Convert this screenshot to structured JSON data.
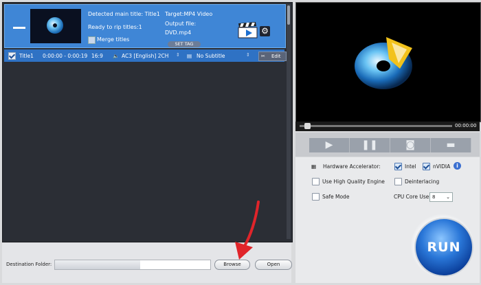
{
  "title_card": {
    "detected_main_title": "Detected main title: Title1",
    "ready_to_rip": "Ready to rip titles:1",
    "merge_titles_label": "Merge titles",
    "target": "Target:MP4 Video",
    "output_file_label": "Output file:",
    "output_file_name": "DVD.mp4",
    "set_tag_label": "SET TAG"
  },
  "track_row": {
    "title": "Title1",
    "time_range": "0:00:00 - 0:00:19",
    "aspect": "16:9",
    "audio": "AC3  [English]  2CH",
    "subtitle": "No Subtitle",
    "edit_label": "Edit"
  },
  "destination": {
    "label": "Destination Folder:",
    "progress": 0.55,
    "browse_label": "Browse",
    "open_label": "Open"
  },
  "preview": {
    "time": "00:00:00",
    "seek_position": 0.03
  },
  "options": {
    "hardware_accelerator_label": "Hardware Accelerator:",
    "intel_label": "Intel",
    "intel_checked": true,
    "nvidia_label": "nVIDIA",
    "nvidia_checked": true,
    "high_quality_label": "Use High Quality Engine",
    "high_quality_checked": false,
    "deinterlacing_label": "Deinterlacing",
    "deinterlacing_checked": false,
    "safe_mode_label": "Safe Mode",
    "safe_mode_checked": false,
    "cpu_core_label": "CPU Core Use:",
    "cpu_core_value": "8"
  },
  "run_label": "RUN",
  "icons": [
    "play-icon",
    "pause-icon",
    "camera-icon",
    "folder-icon",
    "gear-icon",
    "edit-icon",
    "speaker-icon",
    "subtitle-icon",
    "info-icon",
    "chip-icon"
  ],
  "colors": {
    "selection_blue": "#3f86d6",
    "track_blue": "#2f72c4",
    "dark_panel": "#2b2e35",
    "run_blue": "#2a77d8",
    "arrow_red": "#e0242a"
  }
}
